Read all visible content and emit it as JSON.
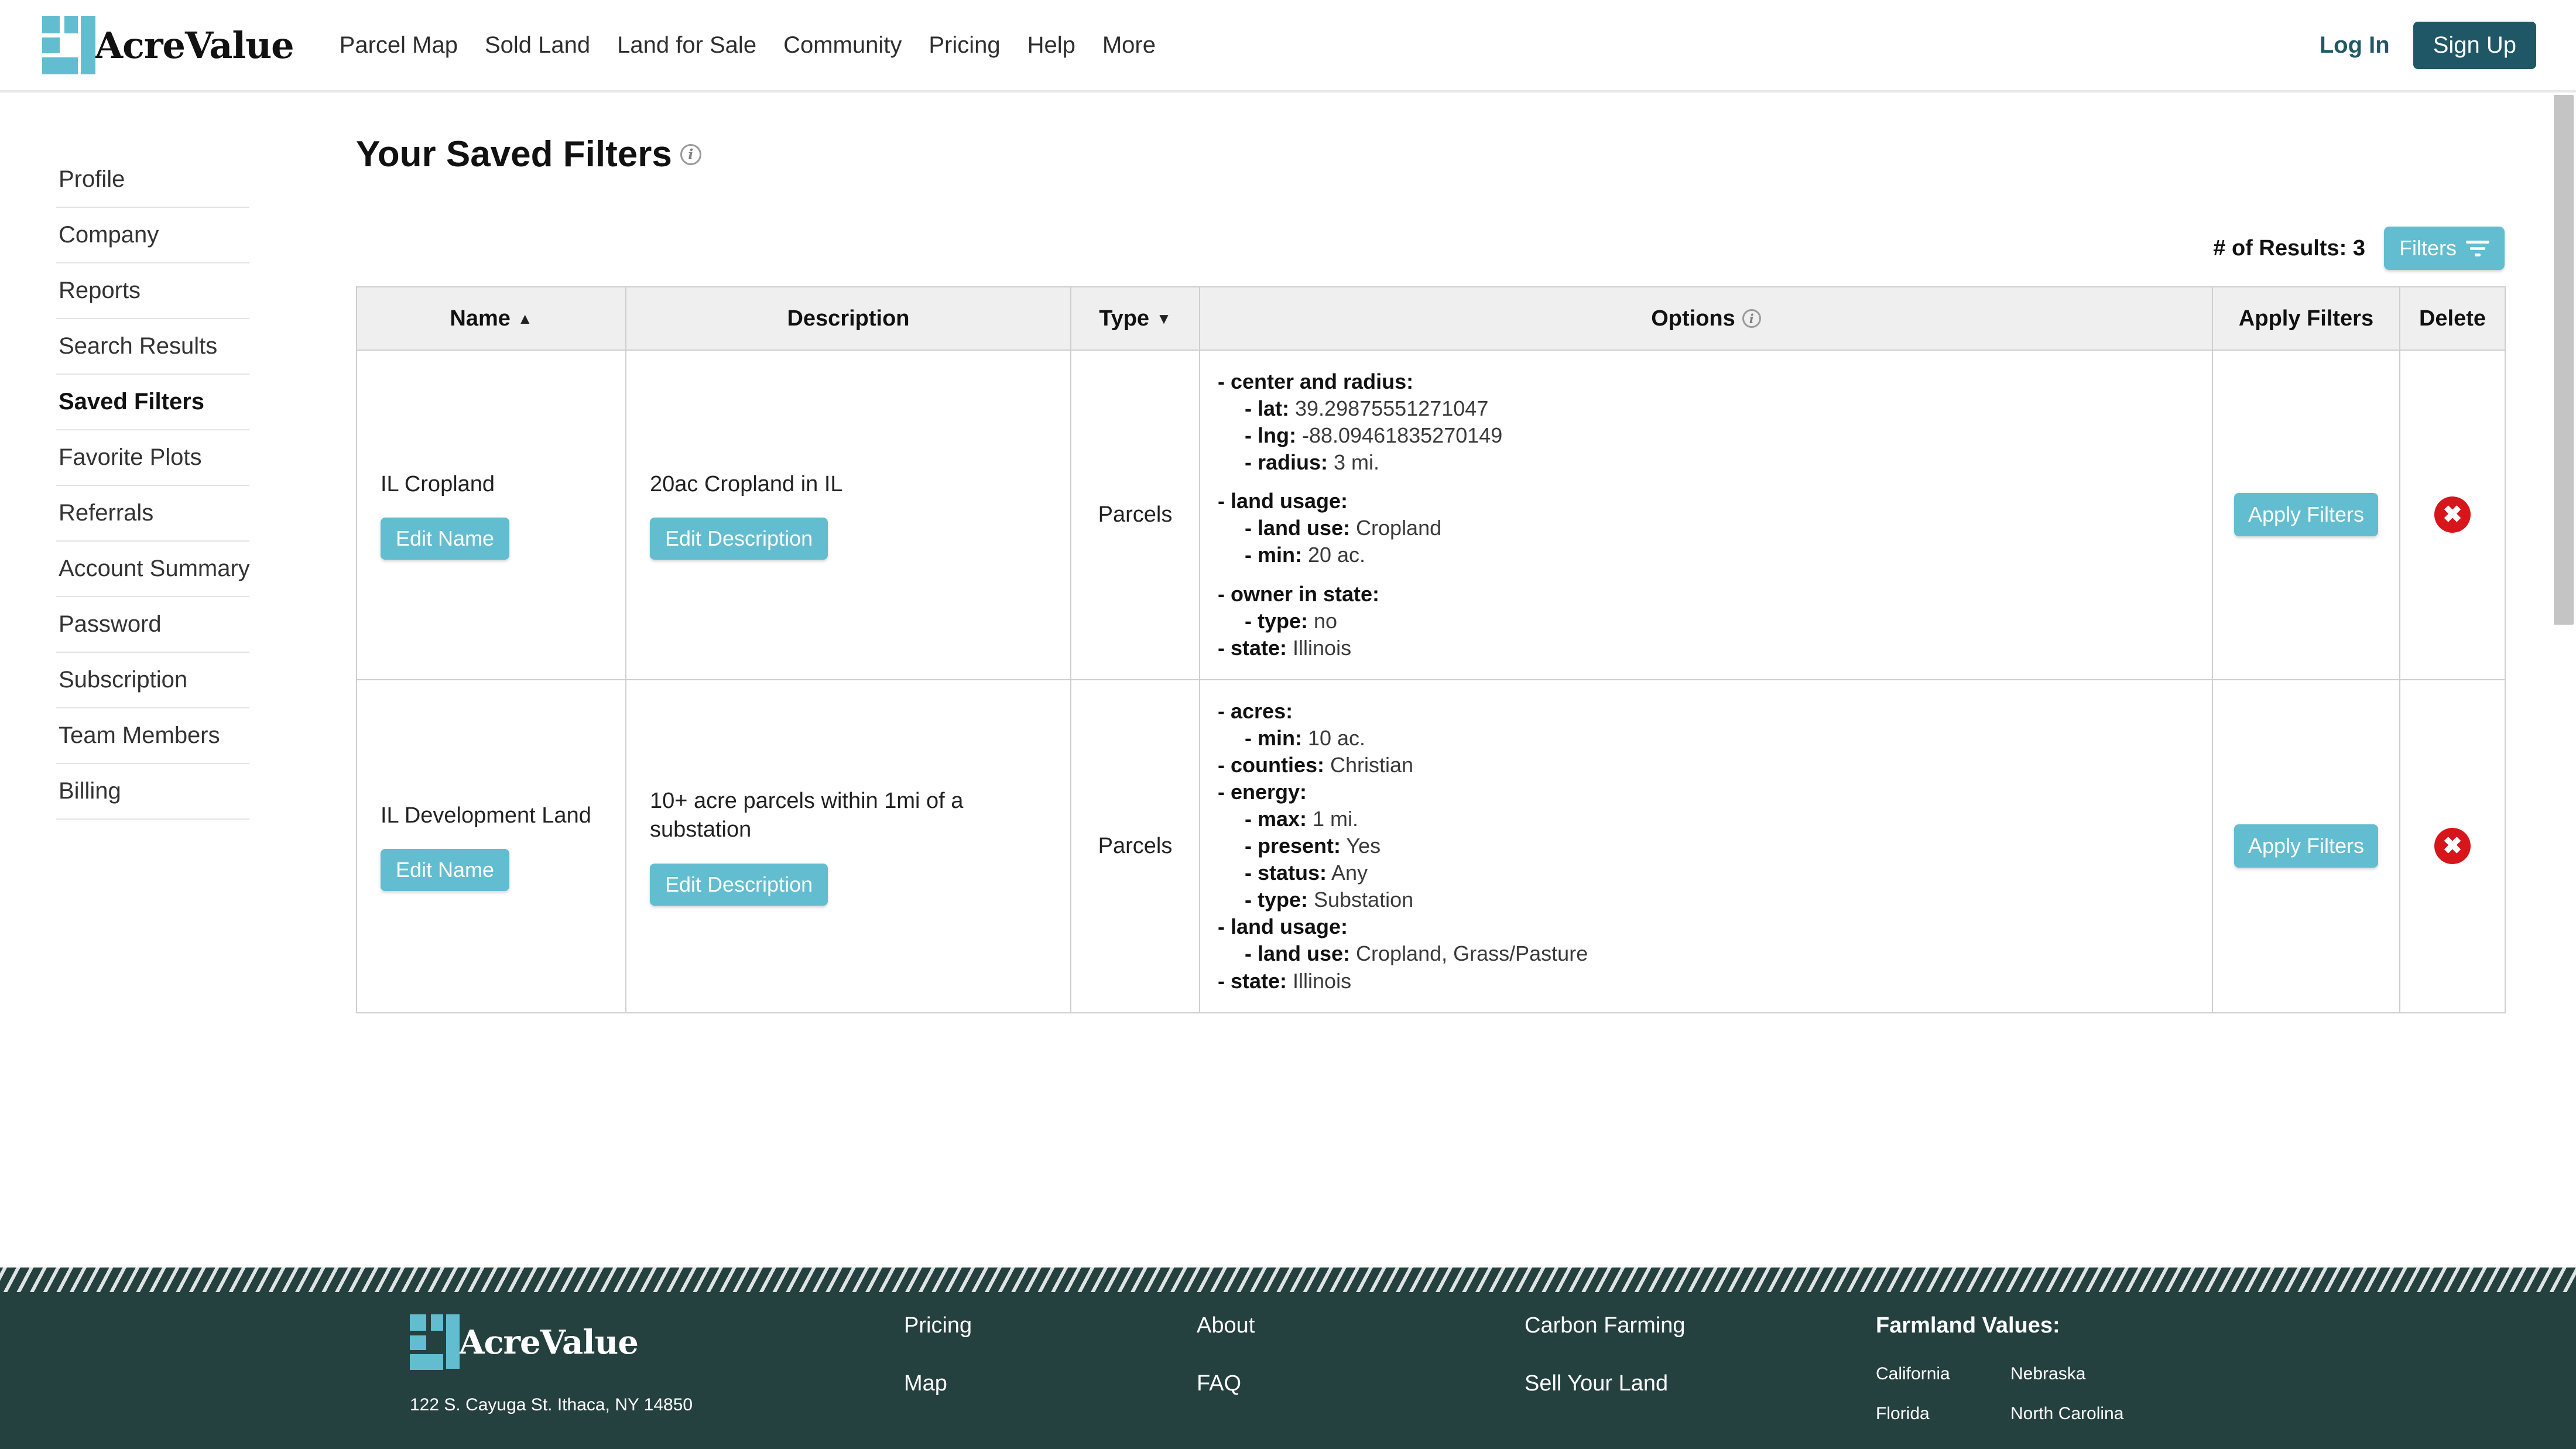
{
  "header": {
    "brand": "AcreValue",
    "nav": [
      {
        "label": "Parcel Map"
      },
      {
        "label": "Sold Land"
      },
      {
        "label": "Land for Sale"
      },
      {
        "label": "Community"
      },
      {
        "label": "Pricing"
      },
      {
        "label": "Help"
      },
      {
        "label": "More"
      }
    ],
    "login_label": "Log In",
    "signup_label": "Sign Up"
  },
  "sidebar": {
    "items": [
      {
        "label": "Profile",
        "active": false
      },
      {
        "label": "Company",
        "active": false
      },
      {
        "label": "Reports",
        "active": false
      },
      {
        "label": "Search Results",
        "active": false
      },
      {
        "label": "Saved Filters",
        "active": true
      },
      {
        "label": "Favorite Plots",
        "active": false
      },
      {
        "label": "Referrals",
        "active": false
      },
      {
        "label": "Account Summary",
        "active": false
      },
      {
        "label": "Password",
        "active": false
      },
      {
        "label": "Subscription",
        "active": false
      },
      {
        "label": "Team Members",
        "active": false
      },
      {
        "label": "Billing",
        "active": false
      }
    ]
  },
  "main": {
    "page_title": "Your Saved Filters",
    "title_info_icon": "info-icon",
    "results_count_label": "# of Results: 3",
    "filters_button_label": "Filters",
    "table": {
      "columns": [
        {
          "label": "Name",
          "sort": "asc"
        },
        {
          "label": "Description",
          "sort": "none"
        },
        {
          "label": "Type",
          "sort": "desc"
        },
        {
          "label": "Options",
          "sort": "none",
          "info": true
        },
        {
          "label": "Apply Filters",
          "sort": "none"
        },
        {
          "label": "Delete",
          "sort": "none"
        }
      ],
      "edit_name_label": "Edit Name",
      "edit_description_label": "Edit Description",
      "apply_filters_label": "Apply Filters",
      "delete_icon": "close-circle-icon",
      "rows": [
        {
          "name": "IL Cropland",
          "description": "20ac Cropland in IL",
          "type": "Parcels",
          "options": [
            {
              "level": 1,
              "key": "- center and radius:",
              "value": ""
            },
            {
              "level": 2,
              "key": "- lat:",
              "value": "39.29875551271047"
            },
            {
              "level": 2,
              "key": "- lng:",
              "value": "-88.09461835270149"
            },
            {
              "level": 2,
              "key": "- radius:",
              "value": "3 mi."
            },
            {
              "level": 0,
              "key": "",
              "value": ""
            },
            {
              "level": 1,
              "key": "- land usage:",
              "value": ""
            },
            {
              "level": 2,
              "key": "- land use:",
              "value": "Cropland"
            },
            {
              "level": 2,
              "key": "- min:",
              "value": "20 ac."
            },
            {
              "level": 0,
              "key": "",
              "value": ""
            },
            {
              "level": 1,
              "key": "- owner in state:",
              "value": ""
            },
            {
              "level": 2,
              "key": "- type:",
              "value": "no"
            },
            {
              "level": 1,
              "key": "- state:",
              "value": "Illinois"
            }
          ]
        },
        {
          "name": "IL Development Land",
          "description": "10+ acre parcels within 1mi of a substation",
          "type": "Parcels",
          "options": [
            {
              "level": 1,
              "key": "- acres:",
              "value": ""
            },
            {
              "level": 2,
              "key": "- min:",
              "value": "10 ac."
            },
            {
              "level": 1,
              "key": "- counties:",
              "value": "Christian"
            },
            {
              "level": 1,
              "key": "- energy:",
              "value": ""
            },
            {
              "level": 2,
              "key": "- max:",
              "value": "1 mi."
            },
            {
              "level": 2,
              "key": "- present:",
              "value": "Yes"
            },
            {
              "level": 2,
              "key": "- status:",
              "value": "Any"
            },
            {
              "level": 2,
              "key": "- type:",
              "value": "Substation"
            },
            {
              "level": 1,
              "key": "- land usage:",
              "value": ""
            },
            {
              "level": 2,
              "key": "- land use:",
              "value": "Cropland, Grass/Pasture"
            },
            {
              "level": 1,
              "key": "- state:",
              "value": "Illinois"
            }
          ]
        }
      ]
    }
  },
  "footer": {
    "brand": "AcreValue",
    "address": "122 S. Cayuga St. Ithaca, NY 14850",
    "col1": [
      {
        "label": "Pricing"
      },
      {
        "label": "Map"
      }
    ],
    "col2": [
      {
        "label": "About"
      },
      {
        "label": "FAQ"
      }
    ],
    "col3": [
      {
        "label": "Carbon Farming"
      },
      {
        "label": "Sell Your Land"
      }
    ],
    "values_title": "Farmland Values:",
    "values": [
      {
        "label": "California"
      },
      {
        "label": "Nebraska"
      },
      {
        "label": "Florida"
      },
      {
        "label": "North Carolina"
      }
    ]
  },
  "colors": {
    "accent_teal": "#62bdd0",
    "dark_teal": "#1f5767",
    "footer_bg": "#24403f",
    "delete_red": "#d6161b"
  }
}
